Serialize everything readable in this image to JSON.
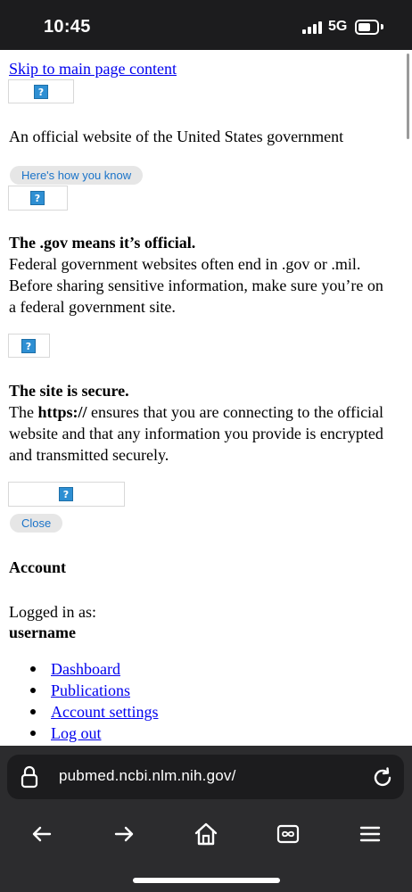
{
  "status_bar": {
    "time": "10:45",
    "network": "5G"
  },
  "page": {
    "skip_link": "Skip to main page content",
    "official_text": "An official website of the United States government",
    "how_you_know_button": "Here's how you know",
    "gov_heading": "The .gov means it’s official.",
    "gov_lines": [
      "Federal government websites often end in .gov or .mil.",
      "Before sharing sensitive information, make sure you’re on",
      "a federal government site."
    ],
    "secure_heading": "The site is secure.",
    "secure_line1_prefix": "The ",
    "secure_https": "https://",
    "secure_line1_suffix": " ensures that you are connecting to the official",
    "secure_lines": [
      "website and that any information you provide is encrypted",
      "and transmitted securely."
    ],
    "close_button": "Close",
    "account_heading": "Account",
    "logged_in_label": "Logged in as:",
    "username": "username",
    "account_links": [
      "Dashboard",
      "Publications",
      "Account settings",
      "Log out"
    ],
    "broken_image_glyph": "?"
  },
  "browser": {
    "url": "pubmed.ncbi.nlm.nih.gov/",
    "toolbar_buttons": [
      "back-icon",
      "forward-icon",
      "home-icon",
      "tabs-icon",
      "menu-icon"
    ]
  }
}
